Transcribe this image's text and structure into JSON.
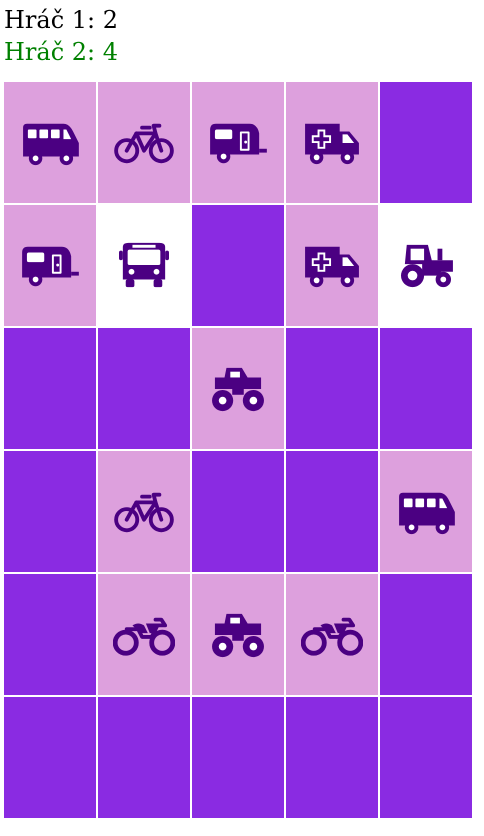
{
  "scores": {
    "player1": "Hráč 1: 2",
    "player2": "Hráč 2: 4",
    "player1_color": "#000000",
    "player2_color": "#008000"
  },
  "board": {
    "rows": 6,
    "cols": 5,
    "colors": {
      "hidden": "#8a2be2",
      "matched": "#dda0dd",
      "revealed": "#ffffff",
      "icon": "#4b0082"
    },
    "cells": [
      {
        "state": "matched",
        "icon": "van"
      },
      {
        "state": "matched",
        "icon": "bicycle"
      },
      {
        "state": "matched",
        "icon": "caravan"
      },
      {
        "state": "matched",
        "icon": "ambulance"
      },
      {
        "state": "hidden",
        "icon": ""
      },
      {
        "state": "matched",
        "icon": "caravan"
      },
      {
        "state": "revealed",
        "icon": "bus"
      },
      {
        "state": "hidden",
        "icon": ""
      },
      {
        "state": "matched",
        "icon": "ambulance"
      },
      {
        "state": "revealed",
        "icon": "tractor"
      },
      {
        "state": "hidden",
        "icon": ""
      },
      {
        "state": "hidden",
        "icon": ""
      },
      {
        "state": "matched",
        "icon": "monster-truck"
      },
      {
        "state": "hidden",
        "icon": ""
      },
      {
        "state": "hidden",
        "icon": ""
      },
      {
        "state": "hidden",
        "icon": ""
      },
      {
        "state": "matched",
        "icon": "bicycle"
      },
      {
        "state": "hidden",
        "icon": ""
      },
      {
        "state": "hidden",
        "icon": ""
      },
      {
        "state": "matched",
        "icon": "van"
      },
      {
        "state": "hidden",
        "icon": ""
      },
      {
        "state": "matched",
        "icon": "motorcycle"
      },
      {
        "state": "matched",
        "icon": "monster-truck"
      },
      {
        "state": "matched",
        "icon": "motorcycle"
      },
      {
        "state": "hidden",
        "icon": ""
      },
      {
        "state": "hidden",
        "icon": ""
      },
      {
        "state": "hidden",
        "icon": ""
      },
      {
        "state": "hidden",
        "icon": ""
      },
      {
        "state": "hidden",
        "icon": ""
      },
      {
        "state": "hidden",
        "icon": ""
      }
    ]
  }
}
